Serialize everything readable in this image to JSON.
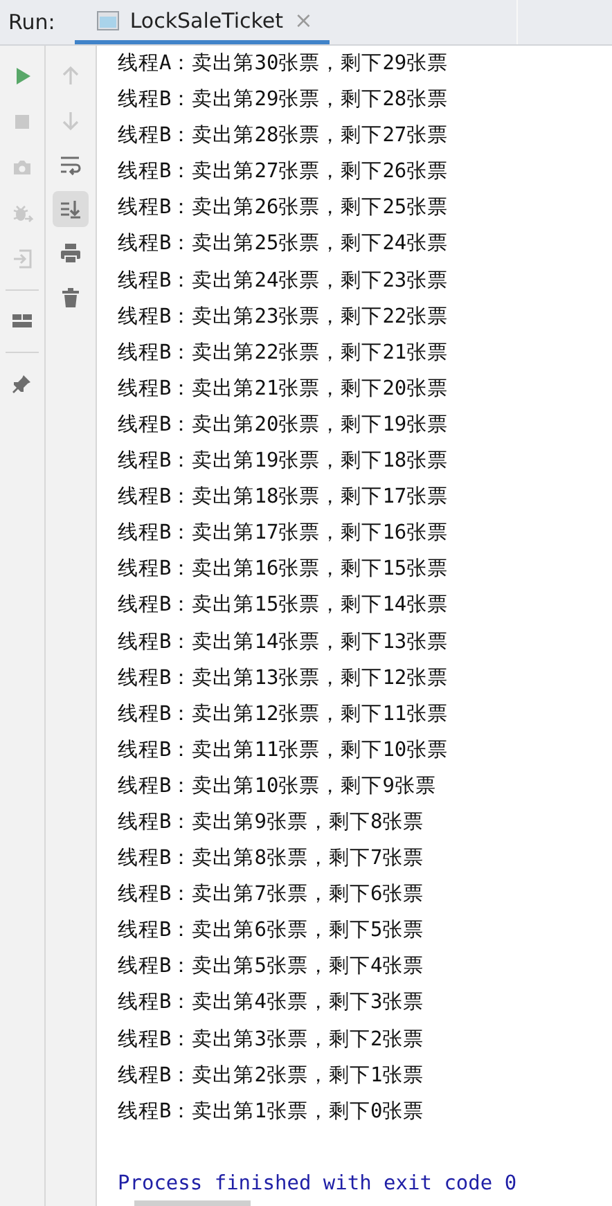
{
  "panel": {
    "label": "Run:"
  },
  "tabs": [
    {
      "label": "LockSaleTicket",
      "close": "×",
      "selected": true
    }
  ],
  "left_toolbar": [
    {
      "kind": "run",
      "disabled": false
    },
    {
      "kind": "stop",
      "disabled": true
    },
    {
      "kind": "camera",
      "disabled": true
    },
    {
      "kind": "bug",
      "disabled": true
    },
    {
      "kind": "enter",
      "disabled": true
    },
    {
      "kind": "separator"
    },
    {
      "kind": "layout",
      "disabled": false
    },
    {
      "kind": "separator"
    },
    {
      "kind": "pin",
      "disabled": false
    }
  ],
  "console_toolbar": [
    {
      "kind": "up",
      "on": false
    },
    {
      "kind": "down",
      "on": false
    },
    {
      "kind": "wrap",
      "on": false
    },
    {
      "kind": "scroll-end",
      "on": true
    },
    {
      "kind": "print",
      "on": false
    },
    {
      "kind": "trash",
      "on": false
    }
  ],
  "output": [
    "线程A：卖出第30张票，剩下29张票",
    "线程B：卖出第29张票，剩下28张票",
    "线程B：卖出第28张票，剩下27张票",
    "线程B：卖出第27张票，剩下26张票",
    "线程B：卖出第26张票，剩下25张票",
    "线程B：卖出第25张票，剩下24张票",
    "线程B：卖出第24张票，剩下23张票",
    "线程B：卖出第23张票，剩下22张票",
    "线程B：卖出第22张票，剩下21张票",
    "线程B：卖出第21张票，剩下20张票",
    "线程B：卖出第20张票，剩下19张票",
    "线程B：卖出第19张票，剩下18张票",
    "线程B：卖出第18张票，剩下17张票",
    "线程B：卖出第17张票，剩下16张票",
    "线程B：卖出第16张票，剩下15张票",
    "线程B：卖出第15张票，剩下14张票",
    "线程B：卖出第14张票，剩下13张票",
    "线程B：卖出第13张票，剩下12张票",
    "线程B：卖出第12张票，剩下11张票",
    "线程B：卖出第11张票，剩下10张票",
    "线程B：卖出第10张票，剩下9张票",
    "线程B：卖出第9张票，剩下8张票",
    "线程B：卖出第8张票，剩下7张票",
    "线程B：卖出第7张票，剩下6张票",
    "线程B：卖出第6张票，剩下5张票",
    "线程B：卖出第5张票，剩下4张票",
    "线程B：卖出第4张票，剩下3张票",
    "线程B：卖出第3张票，剩下2张票",
    "线程B：卖出第2张票，剩下1张票",
    "线程B：卖出第1张票，剩下0张票"
  ],
  "exit_message": "Process finished with exit code 0"
}
